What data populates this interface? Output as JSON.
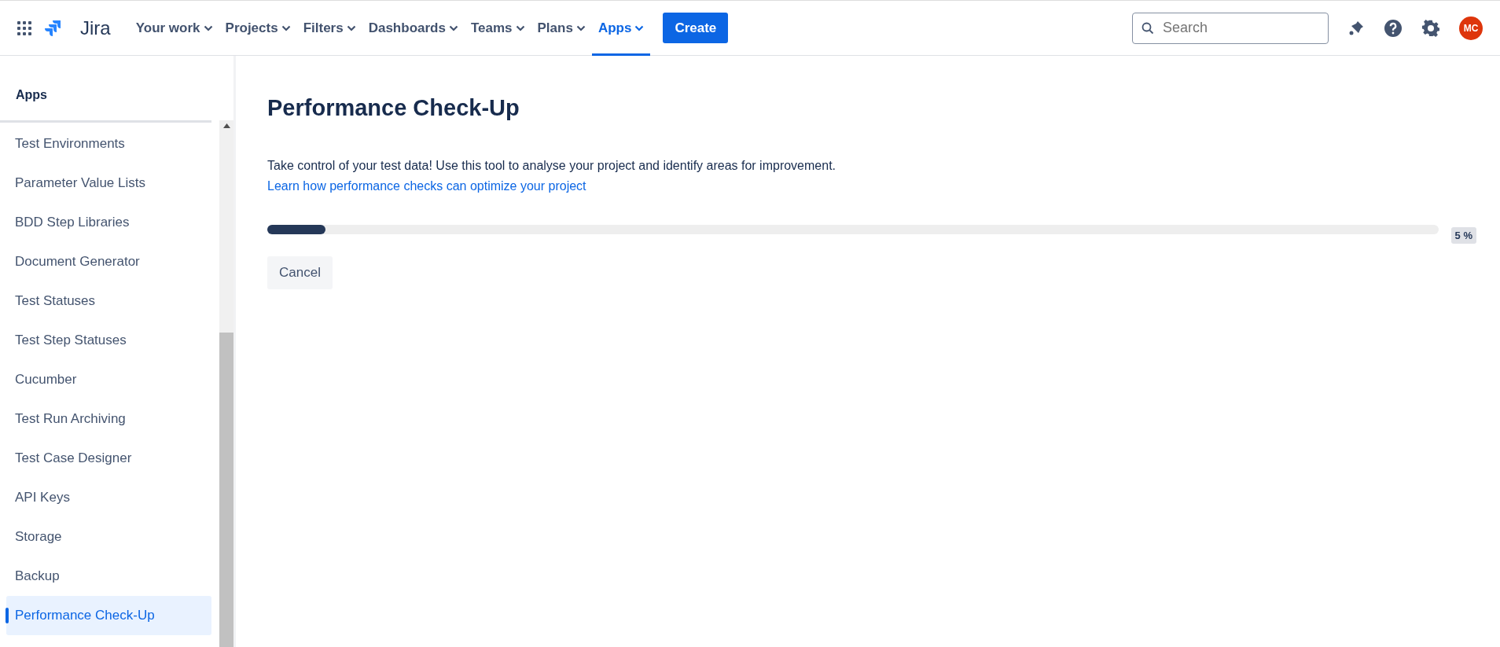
{
  "topnav": {
    "product": "Jira",
    "items": [
      {
        "label": "Your work",
        "selected": false
      },
      {
        "label": "Projects",
        "selected": false
      },
      {
        "label": "Filters",
        "selected": false
      },
      {
        "label": "Dashboards",
        "selected": false
      },
      {
        "label": "Teams",
        "selected": false
      },
      {
        "label": "Plans",
        "selected": false
      },
      {
        "label": "Apps",
        "selected": true
      }
    ],
    "create": "Create",
    "search": {
      "placeholder": "Search"
    },
    "avatar": "MC"
  },
  "sidebar": {
    "title": "Apps",
    "items": [
      {
        "label": "Test Environments",
        "selected": false
      },
      {
        "label": "Parameter Value Lists",
        "selected": false
      },
      {
        "label": "BDD Step Libraries",
        "selected": false
      },
      {
        "label": "Document Generator",
        "selected": false
      },
      {
        "label": "Test Statuses",
        "selected": false
      },
      {
        "label": "Test Step Statuses",
        "selected": false
      },
      {
        "label": "Cucumber",
        "selected": false
      },
      {
        "label": "Test Run Archiving",
        "selected": false
      },
      {
        "label": "Test Case Designer",
        "selected": false
      },
      {
        "label": "API Keys",
        "selected": false
      },
      {
        "label": "Storage",
        "selected": false
      },
      {
        "label": "Backup",
        "selected": false
      },
      {
        "label": "Performance Check-Up",
        "selected": true
      }
    ]
  },
  "main": {
    "title": "Performance Check-Up",
    "description": "Take control of your test data! Use this tool to analyse your project and identify areas for improvement.",
    "link": "Learn how performance checks can optimize your project",
    "progress": {
      "level": 0.05,
      "reading": "5 %"
    },
    "cancel": "Cancel"
  }
}
